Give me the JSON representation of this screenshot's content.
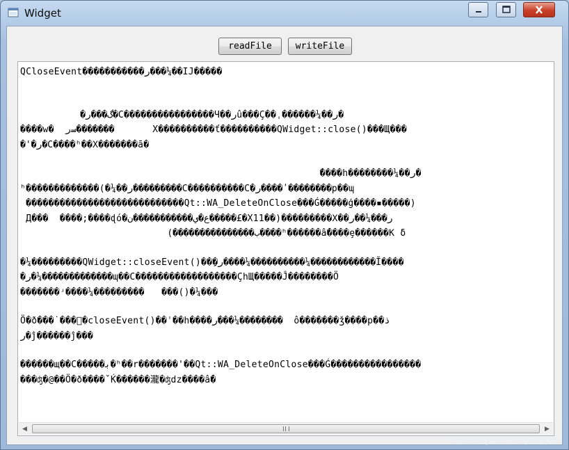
{
  "window": {
    "title": "Widget",
    "icon": "app-window-icon",
    "controls": [
      "minimize-icon",
      "maximize-icon",
      "close-icon"
    ]
  },
  "toolbar": {
    "read_label": "readFile",
    "write_label": "writeFile"
  },
  "editor": {
    "lines": [
      "QCloseEvent�����������ر���¼��IJ�����",
      "",
      "           �گ���ر�C����������������Ч��رû���Ç��ˌ������¼��ر�",
      "����w�  ﺳر�������       X����������ť����������QWidget::close()���Щ���",
      "�'�ر�C����ʰ��Χ�������ā�",
      "",
      "                                                     ̄����h��������¼��ر�",
      "ʰ�������������(�¼��ر���������C����������C�ر����ʹ��������p��ɰ",
      " ����������������������������Qt::WA_DeleteOnClose���Ǵ�����ģ����▪�����)",
      " Д���  ����;����ɖó�ع�ي�����������ن�����£�X11��)���������Χ��ر���¼��ر",
      "                           (���������������ب����ʰ������ấ����ȩ������Κ δ",
      "",
      "�¼���������QWidget::closeEvent()���ِر����¼����������¼������������Ĭ����",
      "�ر�¼�������������ɰ��C������������������ÇhЩ�����Ĵ��������Ö",
      "�������ʴ����¼���������   ���()�¼���",
      "",
      "Ö�ð���˙���ͤ�closeEvent()��ˈ��h����ر���¼��������  ô�������ǯ����p��ذ",
      "ر�ĵ������ĵ���",
      "",
      "������щ��C�����ﺑ�ʰ��r�������'��Qt::WA_DeleteOnClose���Ǵ����������������",
      "���ʤ�@��Ö�ð����ˇЌ������瀧�ʤdz����ấ�"
    ]
  },
  "scrollbar": {
    "left_icon": "scroll-left-icon",
    "right_icon": "scroll-right-icon",
    "thumb_fraction": 0.97
  },
  "watermark": {
    "text": "https://blog.csdn.net/prropprpu"
  }
}
